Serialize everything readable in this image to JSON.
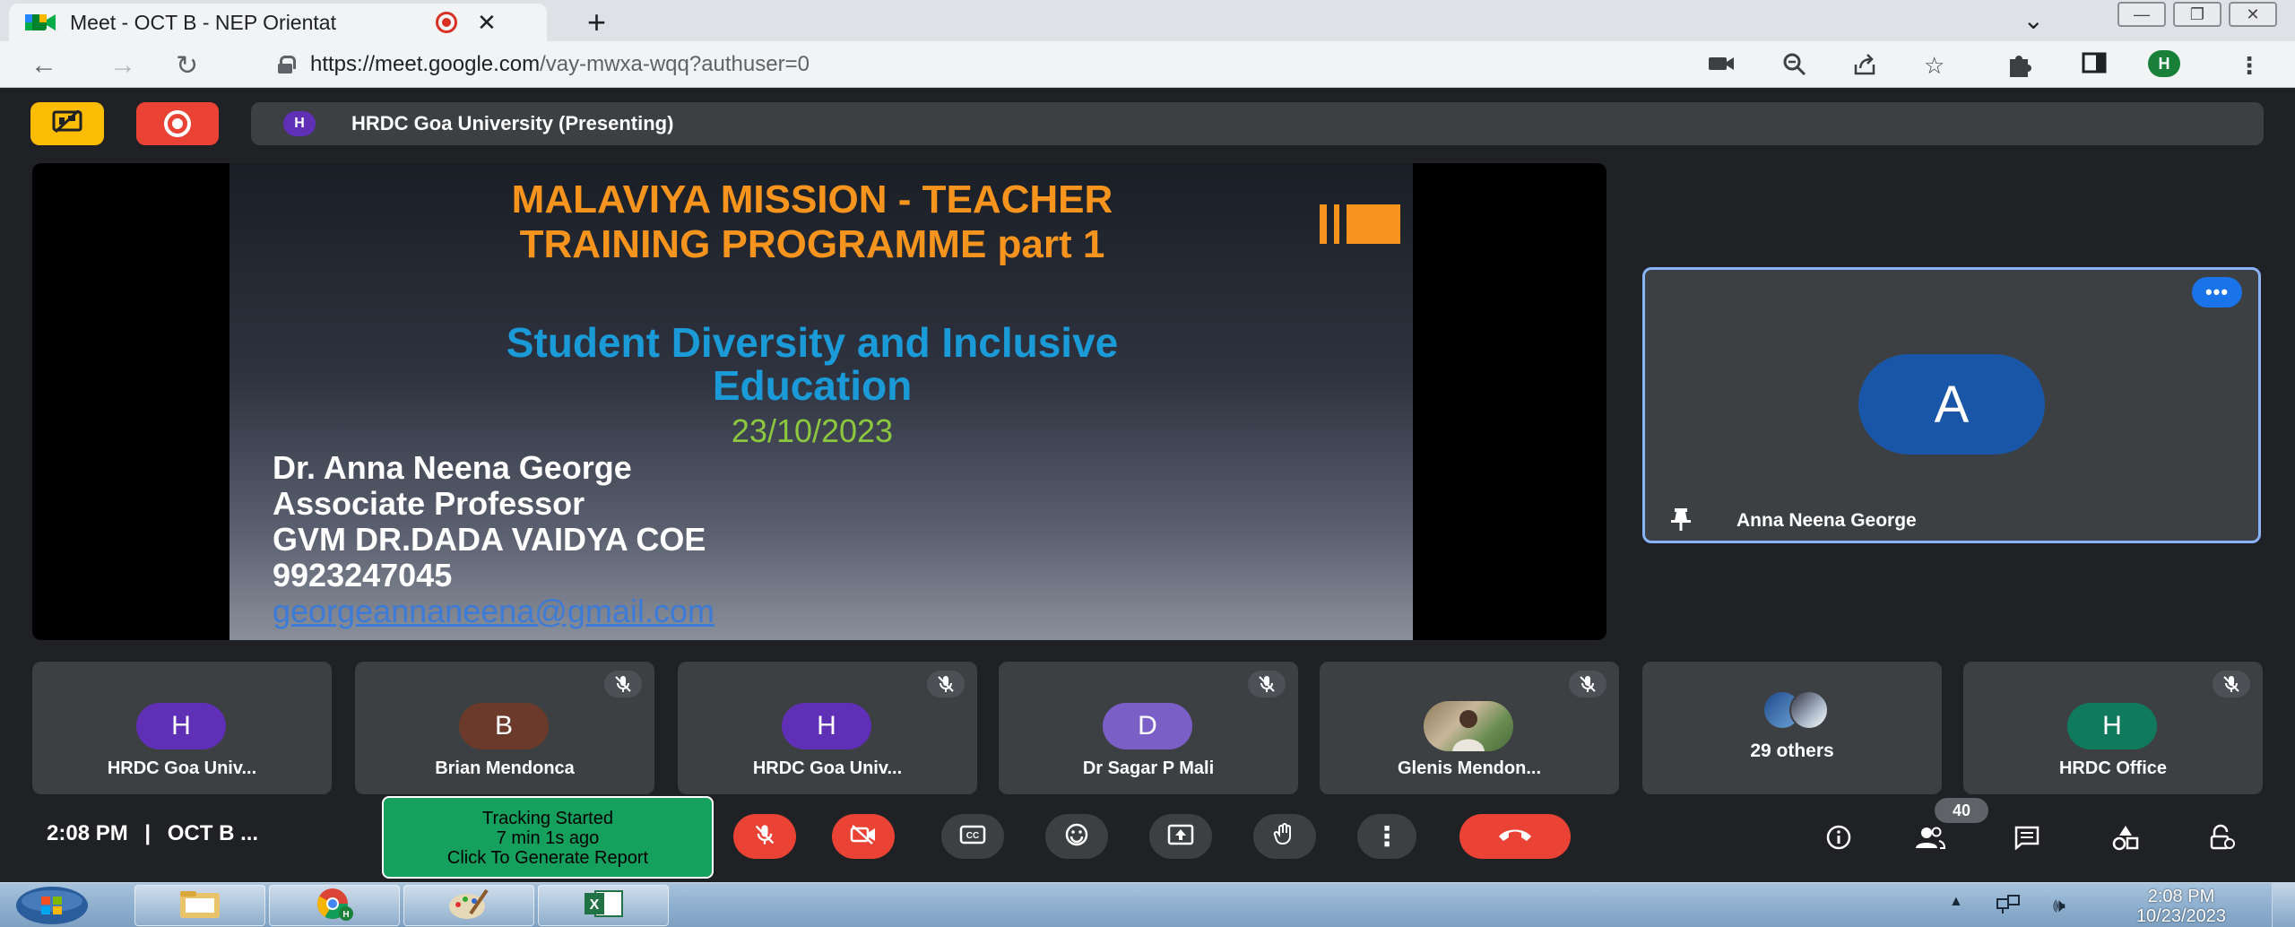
{
  "browser": {
    "tab_title": "Meet - OCT B - NEP Orientat",
    "url_host": "https://meet.google.com",
    "url_path": "/vay-mwxa-wqq?authuser=0",
    "profile_initial": "H"
  },
  "meet": {
    "presenting_initial": "H",
    "presenting_label": "HRDC Goa University (Presenting)",
    "slide": {
      "title_line1": "MALAVIYA MISSION - TEACHER",
      "title_line2": "TRAINING PROGRAMME part 1",
      "subtitle_line1": "Student Diversity and Inclusive",
      "subtitle_line2": "Education",
      "date": "23/10/2023",
      "name": "Dr. Anna Neena George",
      "role": "Associate Professor",
      "org": "GVM DR.DADA VAIDYA COE",
      "phone": "9923247045",
      "email": "georgeannaneena@gmail.com"
    },
    "self_tile": {
      "initial": "A",
      "name": "Anna Neena George",
      "avatar_color": "#1a56a8"
    },
    "participants": [
      {
        "initial": "H",
        "name": "HRDC Goa Univ...",
        "color": "#5f2fb5",
        "muted": false
      },
      {
        "initial": "B",
        "name": "Brian Mendonca",
        "color": "#6b3a2a",
        "muted": true
      },
      {
        "initial": "H",
        "name": "HRDC Goa Univ...",
        "color": "#5f2fb5",
        "muted": true
      },
      {
        "initial": "D",
        "name": "Dr Sagar P Mali",
        "color": "#7b5fc7",
        "muted": true
      },
      {
        "initial": "",
        "name": "Glenis Mendon...",
        "color": "",
        "muted": true
      },
      {
        "initial": "",
        "name": "29 others",
        "color": "",
        "muted": false
      },
      {
        "initial": "H",
        "name": "HRDC Office",
        "color": "#0f7a5c",
        "muted": true
      }
    ],
    "meeting_time": "2:08 PM",
    "meeting_separator": "|",
    "meeting_name": "OCT B ...",
    "tracking": {
      "line1": "Tracking Started",
      "line2": "7 min 1s ago",
      "line3": "Click To Generate Report"
    },
    "people_count": "40"
  },
  "taskbar": {
    "time": "2:08 PM",
    "date": "10/23/2023"
  },
  "colors": {
    "meet_bg": "#202124",
    "tile_bg": "#3c4043",
    "accent_blue": "#8ab4f8",
    "danger_red": "#ea4335",
    "slide_title_orange": "#f7941d",
    "slide_subtitle_blue": "#1b9ad8",
    "slide_date_green": "#8dc63f",
    "tracking_green": "#16a05d"
  },
  "icons": [
    "meet-favicon-icon",
    "recording-icon",
    "close-icon",
    "new-tab-icon",
    "back-icon",
    "forward-icon",
    "reload-icon",
    "lock-icon",
    "camera-icon",
    "zoom-icon",
    "share-icon",
    "bookmark-star-icon",
    "extensions-icon",
    "side-panel-icon",
    "kebab-menu-icon",
    "hide-presentation-icon",
    "more-options-icon",
    "pin-icon",
    "mic-off-icon",
    "camera-off-icon",
    "captions-icon",
    "emoji-icon",
    "present-icon",
    "raise-hand-icon",
    "more-vert-icon",
    "end-call-icon",
    "info-icon",
    "people-icon",
    "chat-icon",
    "activities-icon",
    "host-controls-icon"
  ]
}
